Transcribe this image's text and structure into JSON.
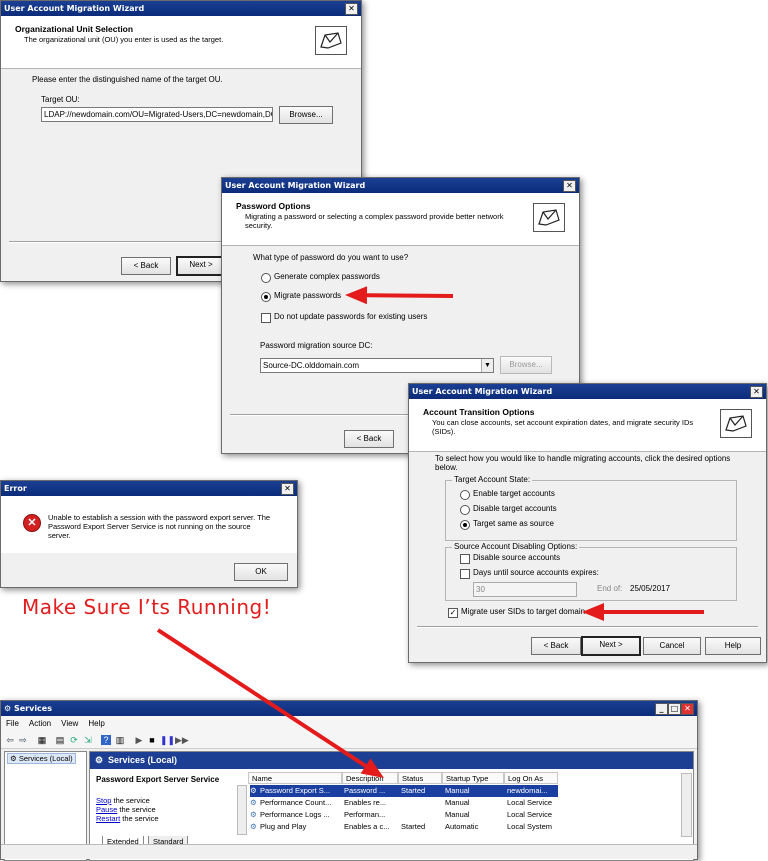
{
  "ou_wizard": {
    "title": "User Account Migration Wizard",
    "close": "✕",
    "header_title": "Organizational Unit Selection",
    "header_subtitle": "The organizational unit (OU) you enter is used as the target.",
    "prompt": "Please enter the distinguished name of the target OU.",
    "target_label": "Target OU:",
    "target_value": "LDAP://newdomain.com/OU=Migrated-Users,DC=newdomain,DC=",
    "browse": "Browse...",
    "back": "< Back",
    "next": "Next >"
  },
  "password_wizard": {
    "title": "User Account Migration Wizard",
    "close": "✕",
    "header_title": "Password Options",
    "header_subtitle": "Migrating a password or selecting a complex password provide better network security.",
    "question": "What type of password do you want to use?",
    "option_complex": "Generate complex passwords",
    "option_migrate": "Migrate passwords",
    "option_no_update": "Do not update passwords for existing users",
    "source_dc_label": "Password migration source DC:",
    "source_dc_value": "Source-DC.olddomain.com",
    "browse": "Browse...",
    "back": "< Back"
  },
  "transition_wizard": {
    "title": "User Account Migration Wizard",
    "close": "✕",
    "header_title": "Account Transition Options",
    "header_subtitle": "You can close accounts, set account expiration dates, and migrate security IDs (SIDs).",
    "intro": "To select how you would like to handle migrating accounts, click the desired options below.",
    "target_state_label": "Target Account State:",
    "enable_target": "Enable target accounts",
    "disable_target": "Disable target accounts",
    "same_as_source": "Target same as source",
    "disabling_label": "Source Account Disabling Options:",
    "disable_source": "Disable source accounts",
    "days_until": "Days until source accounts expires:",
    "days_value": "30",
    "end_of_label": "End of:",
    "end_of_value": "25/05/2017",
    "migrate_sids": "Migrate user SIDs to target domain",
    "back": "< Back",
    "next": "Next >",
    "cancel": "Cancel",
    "help": "Help"
  },
  "error_dialog": {
    "title": "Error",
    "close": "✕",
    "message": "Unable to establish a session with the password export server. The Password Export Server Service is not running on the source server.",
    "ok": "OK"
  },
  "caption": "Make Sure I’ts Running!",
  "services": {
    "title": "Services",
    "menu": [
      "File",
      "Action",
      "View",
      "Help"
    ],
    "tree_item": "Services (Local)",
    "pane_title": "Services (Local)",
    "selected_service": "Password Export Server Service",
    "actions": [
      {
        "link": "Stop",
        "rest": " the service"
      },
      {
        "link": "Pause",
        "rest": " the service"
      },
      {
        "link": "Restart",
        "rest": " the service"
      }
    ],
    "columns": [
      "Name",
      "Description",
      "Status",
      "Startup Type",
      "Log On As"
    ],
    "rows": [
      [
        "Password Export S...",
        "Password ...",
        "Started",
        "Manual",
        "newdomai..."
      ],
      [
        "Performance Count...",
        "Enables re...",
        "",
        "Manual",
        "Local Service"
      ],
      [
        "Performance Logs ...",
        "Performan...",
        "",
        "Manual",
        "Local Service"
      ],
      [
        "Plug and Play",
        "Enables a c...",
        "Started",
        "Automatic",
        "Local System"
      ]
    ],
    "tabs": [
      "Extended",
      "Standard"
    ]
  },
  "colors": {
    "accent_title": "#0c2c7a",
    "arrow": "#e31b1b",
    "selection": "#1a3fa0"
  }
}
